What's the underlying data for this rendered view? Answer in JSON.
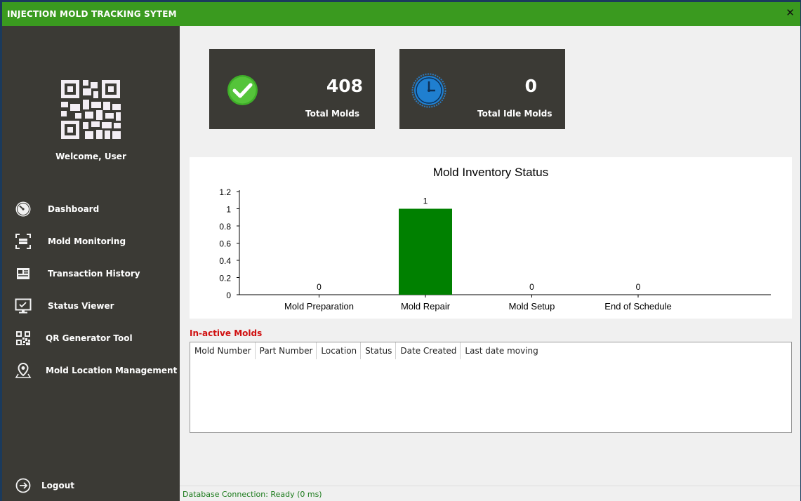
{
  "app": {
    "title": "INJECTION MOLD TRACKING SYTEM",
    "close_glyph": "✕"
  },
  "sidebar": {
    "welcome": "Welcome, User",
    "items": [
      {
        "label": "Dashboard",
        "icon": "dashboard-gauge-icon"
      },
      {
        "label": "Mold Monitoring",
        "icon": "scan-frame-icon"
      },
      {
        "label": "Transaction History",
        "icon": "receipt-icon"
      },
      {
        "label": "Status Viewer",
        "icon": "monitor-icon"
      },
      {
        "label": "QR Generator Tool",
        "icon": "qr-code-icon"
      },
      {
        "label": "Mold Location Management",
        "icon": "location-pin-icon"
      }
    ],
    "logout": "Logout"
  },
  "cards": {
    "total_molds": {
      "value": "408",
      "label": "Total Molds"
    },
    "idle_molds": {
      "value": "0",
      "label": "Total Idle Molds"
    }
  },
  "chart_data": {
    "type": "bar",
    "title": "Mold Inventory Status",
    "categories": [
      "Mold Preparation",
      "Mold Repair",
      "Mold Setup",
      "End of Schedule"
    ],
    "values": [
      0,
      1,
      0,
      0
    ],
    "data_labels": [
      "0",
      "1",
      "0",
      "0"
    ],
    "yticks": [
      "0",
      "0.2",
      "0.4",
      "0.6",
      "0.8",
      "1",
      "1.2"
    ],
    "ylim": [
      0,
      1.2
    ],
    "bar_color": "#008000",
    "grid": false
  },
  "inactive": {
    "title": "In-active Molds",
    "columns": [
      "Mold Number",
      "Part Number",
      "Location",
      "Status",
      "Date Created",
      "Last date moving"
    ],
    "rows": []
  },
  "status_bar": {
    "text": "Database Connection: Ready (0 ms)"
  },
  "colors": {
    "titlebar": "#3a9a1f",
    "sidebar": "#3b3a35",
    "accent_red": "#d01010",
    "status_green": "#1a7a1a"
  }
}
